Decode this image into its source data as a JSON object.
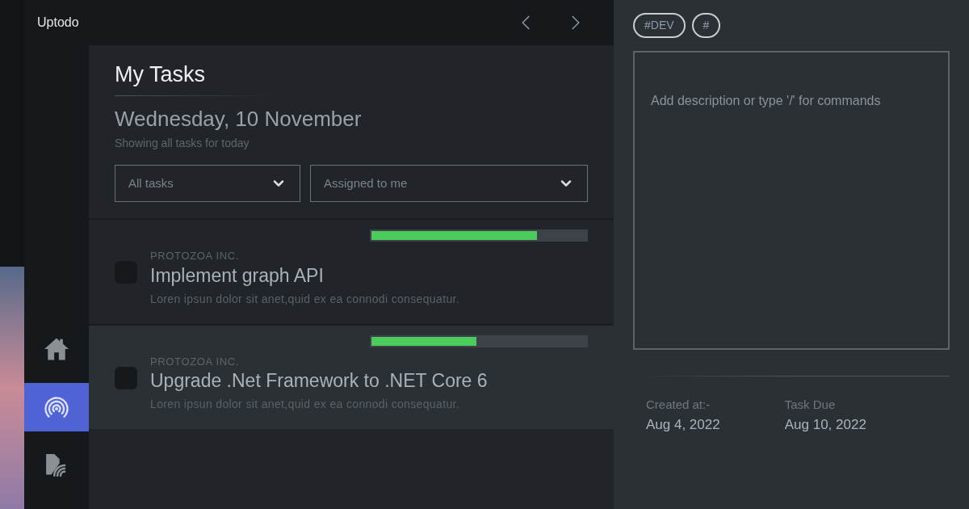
{
  "app": {
    "title": "Uptodo"
  },
  "sidebar": {
    "items": [
      {
        "kind": "home",
        "selected": false
      },
      {
        "kind": "broadcast",
        "selected": true
      },
      {
        "kind": "document_wifi",
        "selected": false
      }
    ]
  },
  "header": {
    "title": "My Tasks",
    "date": "Wednesday, 10 November",
    "subtitle": "Showing all tasks for today"
  },
  "filters": [
    {
      "value": "All tasks"
    },
    {
      "value": "Assigned to me"
    }
  ],
  "tasks": [
    {
      "company": "PROTOZOA INC.",
      "title": "Implement graph API",
      "description": "Loren ipsun dolor sit anet,quid ex ea connodi consequatur.",
      "level": 0.77,
      "checked": false,
      "selected": false
    },
    {
      "company": "PROTOZOA INC.",
      "title": "Upgrade .Net Framework to .NET Core 6",
      "description": "Loren ipsun dolor sit anet,quid ex ea connodi consequatur.",
      "level": 0.49,
      "checked": false,
      "selected": true
    }
  ],
  "details": {
    "tags": [
      {
        "label": "#DEV"
      },
      {
        "label": "#"
      }
    ],
    "description": {
      "placeholder": "Add description or type '/' for commands"
    },
    "created": {
      "label": "Created at:-",
      "value": "Aug 4, 2022"
    },
    "due": {
      "label": "Task Due",
      "value": "Aug 10, 2022"
    }
  }
}
